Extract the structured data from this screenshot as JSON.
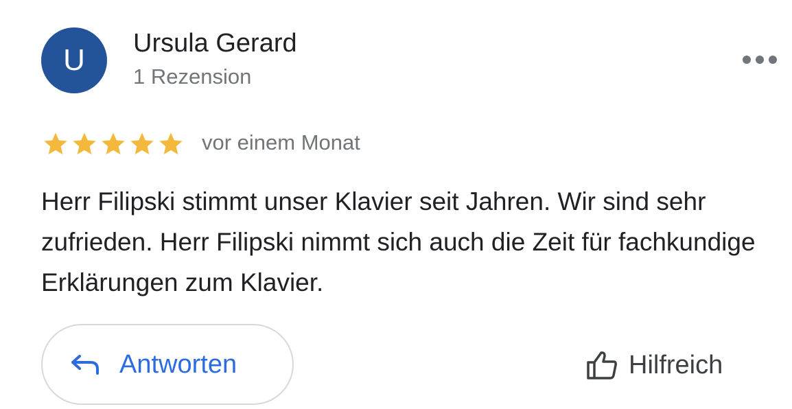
{
  "review": {
    "author": {
      "initial": "U",
      "name": "Ursula Gerard",
      "review_count": "1 Rezension",
      "avatar_color": "#23549a"
    },
    "rating": 5,
    "rating_max": 5,
    "star_color": "#f4b93c",
    "date": "vor einem Monat",
    "text": "Herr Filipski stimmt unser Klavier seit Jahren. Wir sind sehr zufrieden. Herr Filipski nimmt sich auch die Zeit für fachkundige Erklärungen zum Klavier.",
    "more_icon": "more-horizontal-icon"
  },
  "actions": {
    "reply_label": "Antworten",
    "reply_icon": "reply-arrow-icon",
    "helpful_label": "Hilfreich",
    "helpful_icon": "thumbs-up-icon",
    "accent_color": "#2b6ce0"
  }
}
